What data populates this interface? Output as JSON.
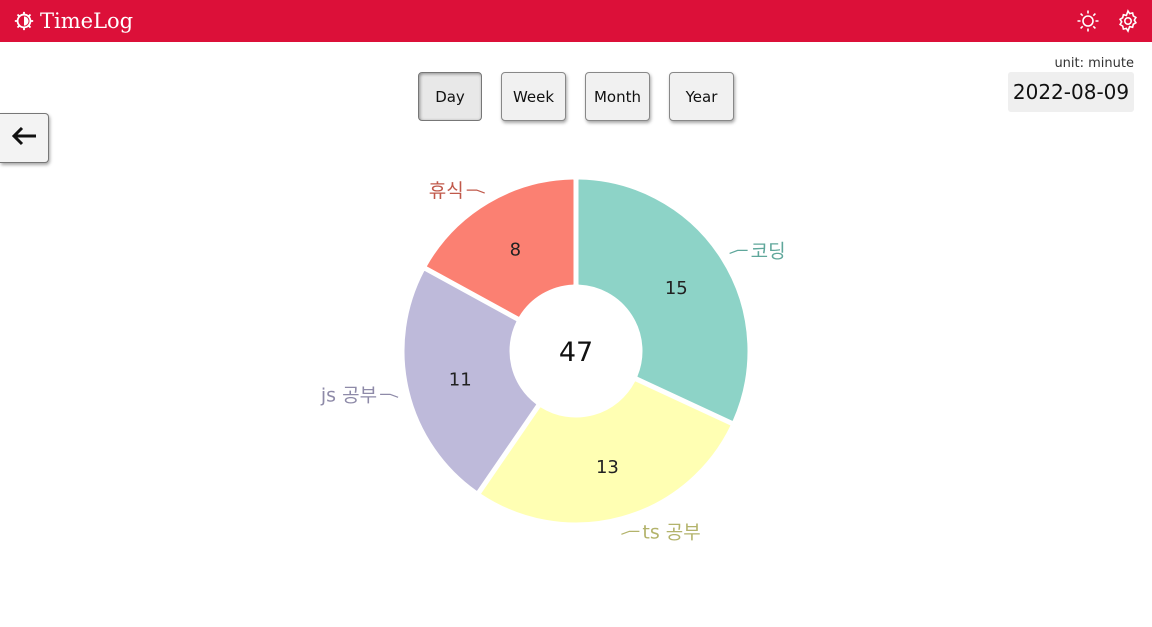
{
  "app": {
    "title": "TimeLog",
    "logo_icon": "gear-logo-icon"
  },
  "header": {
    "actions": [
      {
        "name": "theme-toggle",
        "icon": "sun-icon"
      },
      {
        "name": "settings",
        "icon": "gear-icon"
      }
    ]
  },
  "period_tabs": [
    {
      "label": "Day",
      "active": true
    },
    {
      "label": "Week",
      "active": false
    },
    {
      "label": "Month",
      "active": false
    },
    {
      "label": "Year",
      "active": false
    }
  ],
  "unit_label": "unit: minute",
  "date": "2022-08-09",
  "back_button": {
    "icon": "arrow-left-icon"
  },
  "chart_data": {
    "type": "pie",
    "variant": "donut",
    "total": 47,
    "slices": [
      {
        "label": "코딩",
        "value": 15,
        "color": "#8dd3c7",
        "label_color": "#5fa79b"
      },
      {
        "label": "ts 공부",
        "value": 13,
        "color": "#ffffb3",
        "label_color": "#b3b36b"
      },
      {
        "label": "js 공부",
        "value": 11,
        "color": "#bebada",
        "label_color": "#8e8aa8"
      },
      {
        "label": "휴식",
        "value": 8,
        "color": "#fb8072",
        "label_color": "#c0584a"
      }
    ]
  }
}
